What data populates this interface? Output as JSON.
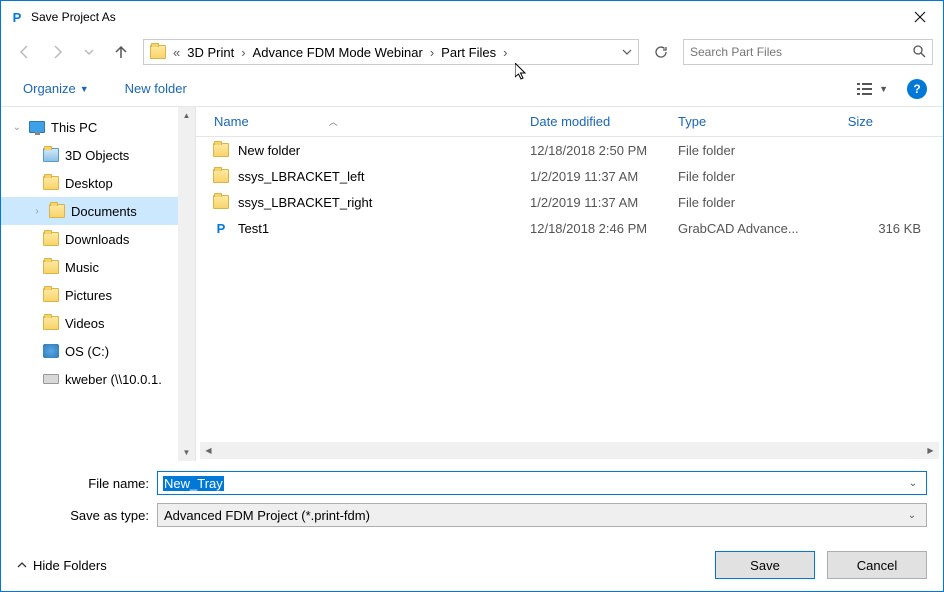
{
  "title": "Save Project As",
  "breadcrumb": {
    "seg0": "3D Print",
    "seg1": "Advance FDM Mode Webinar",
    "seg2": "Part Files"
  },
  "search": {
    "placeholder": "Search Part Files"
  },
  "toolbar": {
    "organize": "Organize",
    "new_folder": "New folder"
  },
  "sidebar": {
    "this_pc": "This PC",
    "items": [
      "3D Objects",
      "Desktop",
      "Documents",
      "Downloads",
      "Music",
      "Pictures",
      "Videos",
      "OS (C:)",
      "kweber (\\\\10.0.1."
    ]
  },
  "headers": {
    "name": "Name",
    "date": "Date modified",
    "type": "Type",
    "size": "Size"
  },
  "files": [
    {
      "name": "New folder",
      "date": "12/18/2018 2:50 PM",
      "type": "File folder",
      "size": "",
      "icon": "folder"
    },
    {
      "name": "ssys_LBRACKET_left",
      "date": "1/2/2019 11:37 AM",
      "type": "File folder",
      "size": "",
      "icon": "folder"
    },
    {
      "name": "ssys_LBRACKET_right",
      "date": "1/2/2019 11:37 AM",
      "type": "File folder",
      "size": "",
      "icon": "folder"
    },
    {
      "name": "Test1",
      "date": "12/18/2018 2:46 PM",
      "type": "GrabCAD Advance...",
      "size": "316 KB",
      "icon": "p"
    }
  ],
  "form": {
    "file_name_label": "File name:",
    "file_name_value": "New_Tray",
    "save_type_label": "Save as type:",
    "save_type_value": "Advanced FDM Project (*.print-fdm)"
  },
  "footer": {
    "hide": "Hide Folders",
    "save": "Save",
    "cancel": "Cancel"
  }
}
